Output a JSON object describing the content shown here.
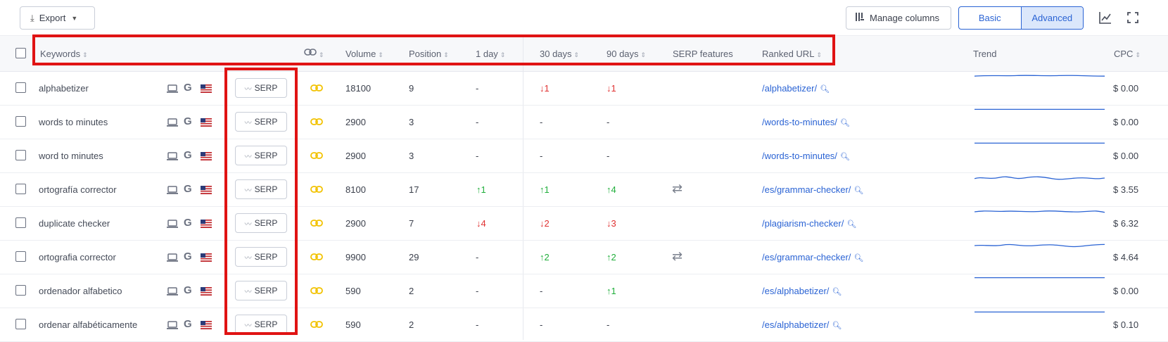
{
  "toolbar": {
    "export_label": "Export",
    "manage_columns_label": "Manage columns",
    "view_basic_label": "Basic",
    "view_advanced_label": "Advanced",
    "active_view": "Advanced"
  },
  "columns": {
    "keywords": "Keywords",
    "volume": "Volume",
    "position": "Position",
    "day1": "1 day",
    "days30": "30 days",
    "days90": "90 days",
    "serp_features": "SERP features",
    "ranked_url": "Ranked URL",
    "trend": "Trend",
    "cpc": "CPC"
  },
  "serp_label": "SERP",
  "colors": {
    "accent": "#2a63d4",
    "up": "#1fae3a",
    "down": "#e03131",
    "link_icon": "#f2c200",
    "highlight": "#e01313"
  },
  "rows": [
    {
      "keyword": "alphabetizer",
      "volume": "18100",
      "position": "9",
      "d1": "-",
      "d30": "↓1",
      "d90": "↓1",
      "serp_feature": false,
      "url": "/alphabetizer/",
      "cpc": "$ 0.00"
    },
    {
      "keyword": "words to minutes",
      "volume": "2900",
      "position": "3",
      "d1": "-",
      "d30": "-",
      "d90": "-",
      "serp_feature": false,
      "url": "/words-to-minutes/",
      "cpc": "$ 0.00"
    },
    {
      "keyword": "word to minutes",
      "volume": "2900",
      "position": "3",
      "d1": "-",
      "d30": "-",
      "d90": "-",
      "serp_feature": false,
      "url": "/words-to-minutes/",
      "cpc": "$ 0.00"
    },
    {
      "keyword": "ortografía corrector",
      "volume": "8100",
      "position": "17",
      "d1": "↑1",
      "d30": "↑1",
      "d90": "↑4",
      "serp_feature": true,
      "url": "/es/grammar-checker/",
      "cpc": "$ 3.55"
    },
    {
      "keyword": "duplicate checker",
      "volume": "2900",
      "position": "7",
      "d1": "↓4",
      "d30": "↓2",
      "d90": "↓3",
      "serp_feature": false,
      "url": "/plagiarism-checker/",
      "cpc": "$ 6.32"
    },
    {
      "keyword": "ortografia corrector",
      "volume": "9900",
      "position": "29",
      "d1": "-",
      "d30": "↑2",
      "d90": "↑2",
      "serp_feature": true,
      "url": "/es/grammar-checker/",
      "cpc": "$ 4.64"
    },
    {
      "keyword": "ordenador alfabetico",
      "volume": "590",
      "position": "2",
      "d1": "-",
      "d30": "-",
      "d90": "↑1",
      "serp_feature": false,
      "url": "/es/alphabetizer/",
      "cpc": "$ 0.00"
    },
    {
      "keyword": "ordenar alfabéticamente",
      "volume": "590",
      "position": "2",
      "d1": "-",
      "d30": "-",
      "d90": "-",
      "serp_feature": false,
      "url": "/es/alphabetizer/",
      "cpc": "$ 0.10"
    }
  ]
}
